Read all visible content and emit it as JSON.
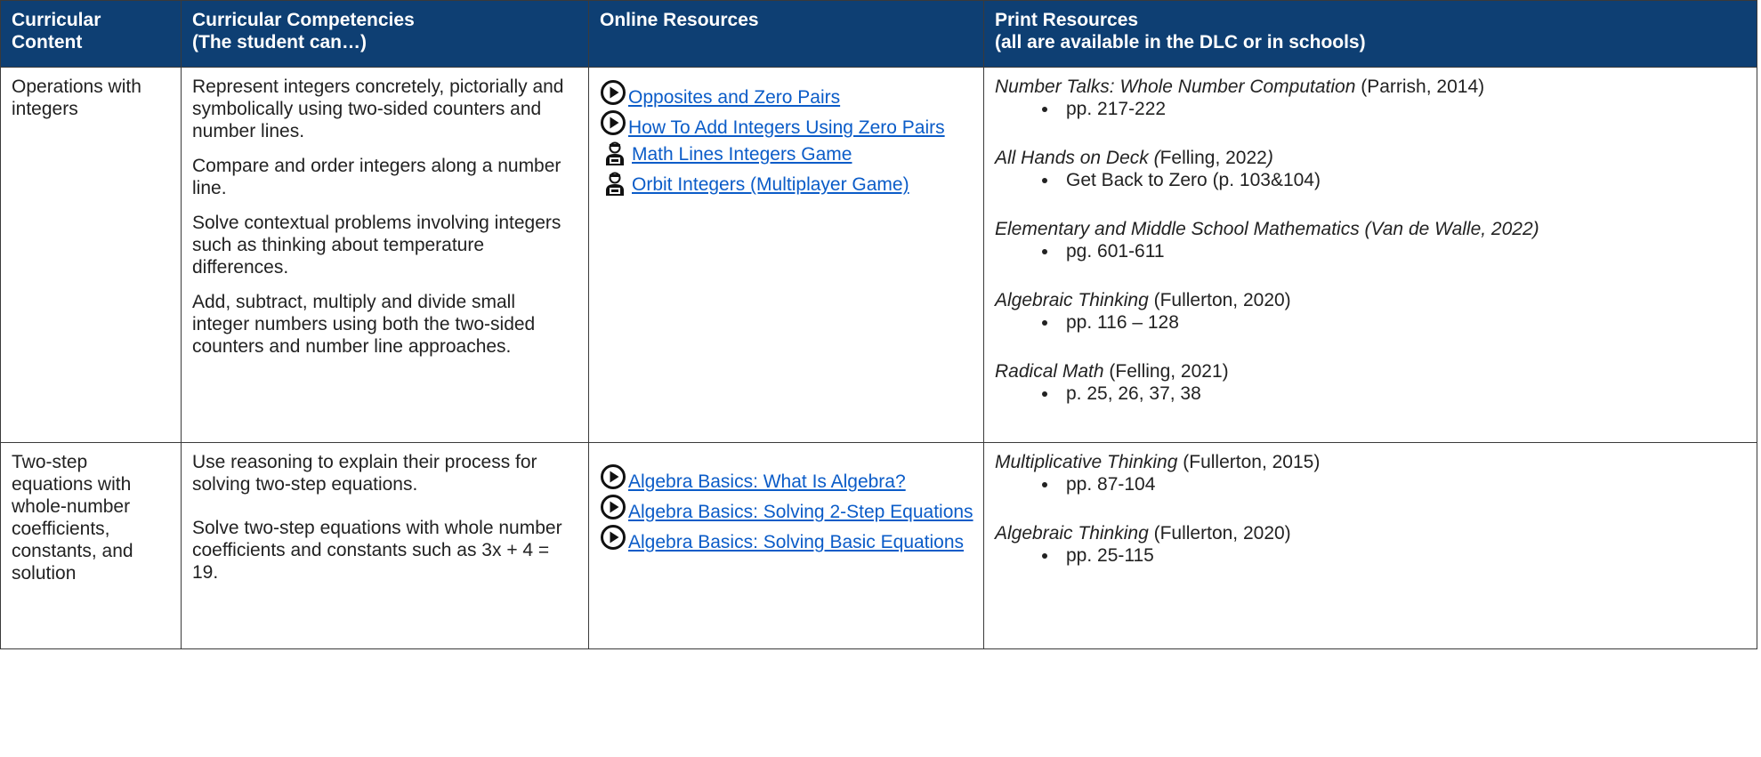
{
  "headers": [
    "Curricular Content",
    "Curricular Competencies\n (The student can…)",
    "Online Resources",
    "Print Resources\n (all are available in the DLC or in schools)"
  ],
  "rows": [
    {
      "content": "Operations with integers",
      "competencies": [
        "Represent integers concretely, pictorially and symbolically using two-sided counters and number lines.",
        "Compare and order integers along a number line.",
        "Solve contextual problems involving integers such as thinking about temperature differences.",
        "Add, subtract, multiply and divide small integer numbers using both the two-sided counters and number line approaches."
      ],
      "online": [
        {
          "icon": "play-circle-icon",
          "label": "Opposites and Zero Pairs"
        },
        {
          "icon": "play-circle-icon",
          "label": "How To Add Integers Using Zero Pairs"
        },
        {
          "icon": "gamer-icon",
          "label": "Math Lines Integers Game"
        },
        {
          "icon": "gamer-icon",
          "label": "Orbit Integers (Multiplayer Game)"
        }
      ],
      "print": [
        {
          "title": "Number Talks: Whole Number Computation",
          "rest": " (Parrish, 2014)",
          "bullet": "pp. 217-222"
        },
        {
          "title": "All Hands on Deck (",
          "rest": "Felling, 2022",
          "title2": ")",
          "bullet": "Get Back to Zero (p. 103&104)"
        },
        {
          "title": "Elementary and Middle School Mathematics (Van de Walle, 2022)",
          "rest": "",
          "bullet": "pg. 601-611"
        },
        {
          "title": "Algebraic Thinking",
          "rest": " (Fullerton, 2020)",
          "bullet": "pp. 116 – 128"
        },
        {
          "title": "Radical Math",
          "rest": " (Felling, 2021)",
          "bullet": "p. 25, 26, 37, 38"
        }
      ]
    },
    {
      "content": "Two-step equations with whole-number coefficients, constants, and solution",
      "competencies": [
        "Use reasoning to explain their process for solving two-step equations.",
        "Solve two-step equations with whole number coefficients and constants such as 3x + 4 = 19."
      ],
      "online": [
        {
          "icon": "play-circle-icon",
          "label": "Algebra Basics: What Is Algebra?"
        },
        {
          "icon": "play-circle-icon",
          "label": "Algebra Basics: Solving 2-Step Equations"
        },
        {
          "icon": "play-circle-icon",
          "label": "Algebra Basics: Solving Basic Equations"
        }
      ],
      "print": [
        {
          "title": "Multiplicative Thinking",
          "rest": " (Fullerton, 2015)",
          "bullet": "pp. 87-104"
        },
        {
          "title": "Algebraic Thinking",
          "rest": " (Fullerton, 2020)",
          "bullet": "pp. 25-115"
        }
      ]
    }
  ],
  "colors": {
    "header_bg": "#0e3f73",
    "link": "#0b5cc8",
    "border": "#3a3a3a"
  }
}
